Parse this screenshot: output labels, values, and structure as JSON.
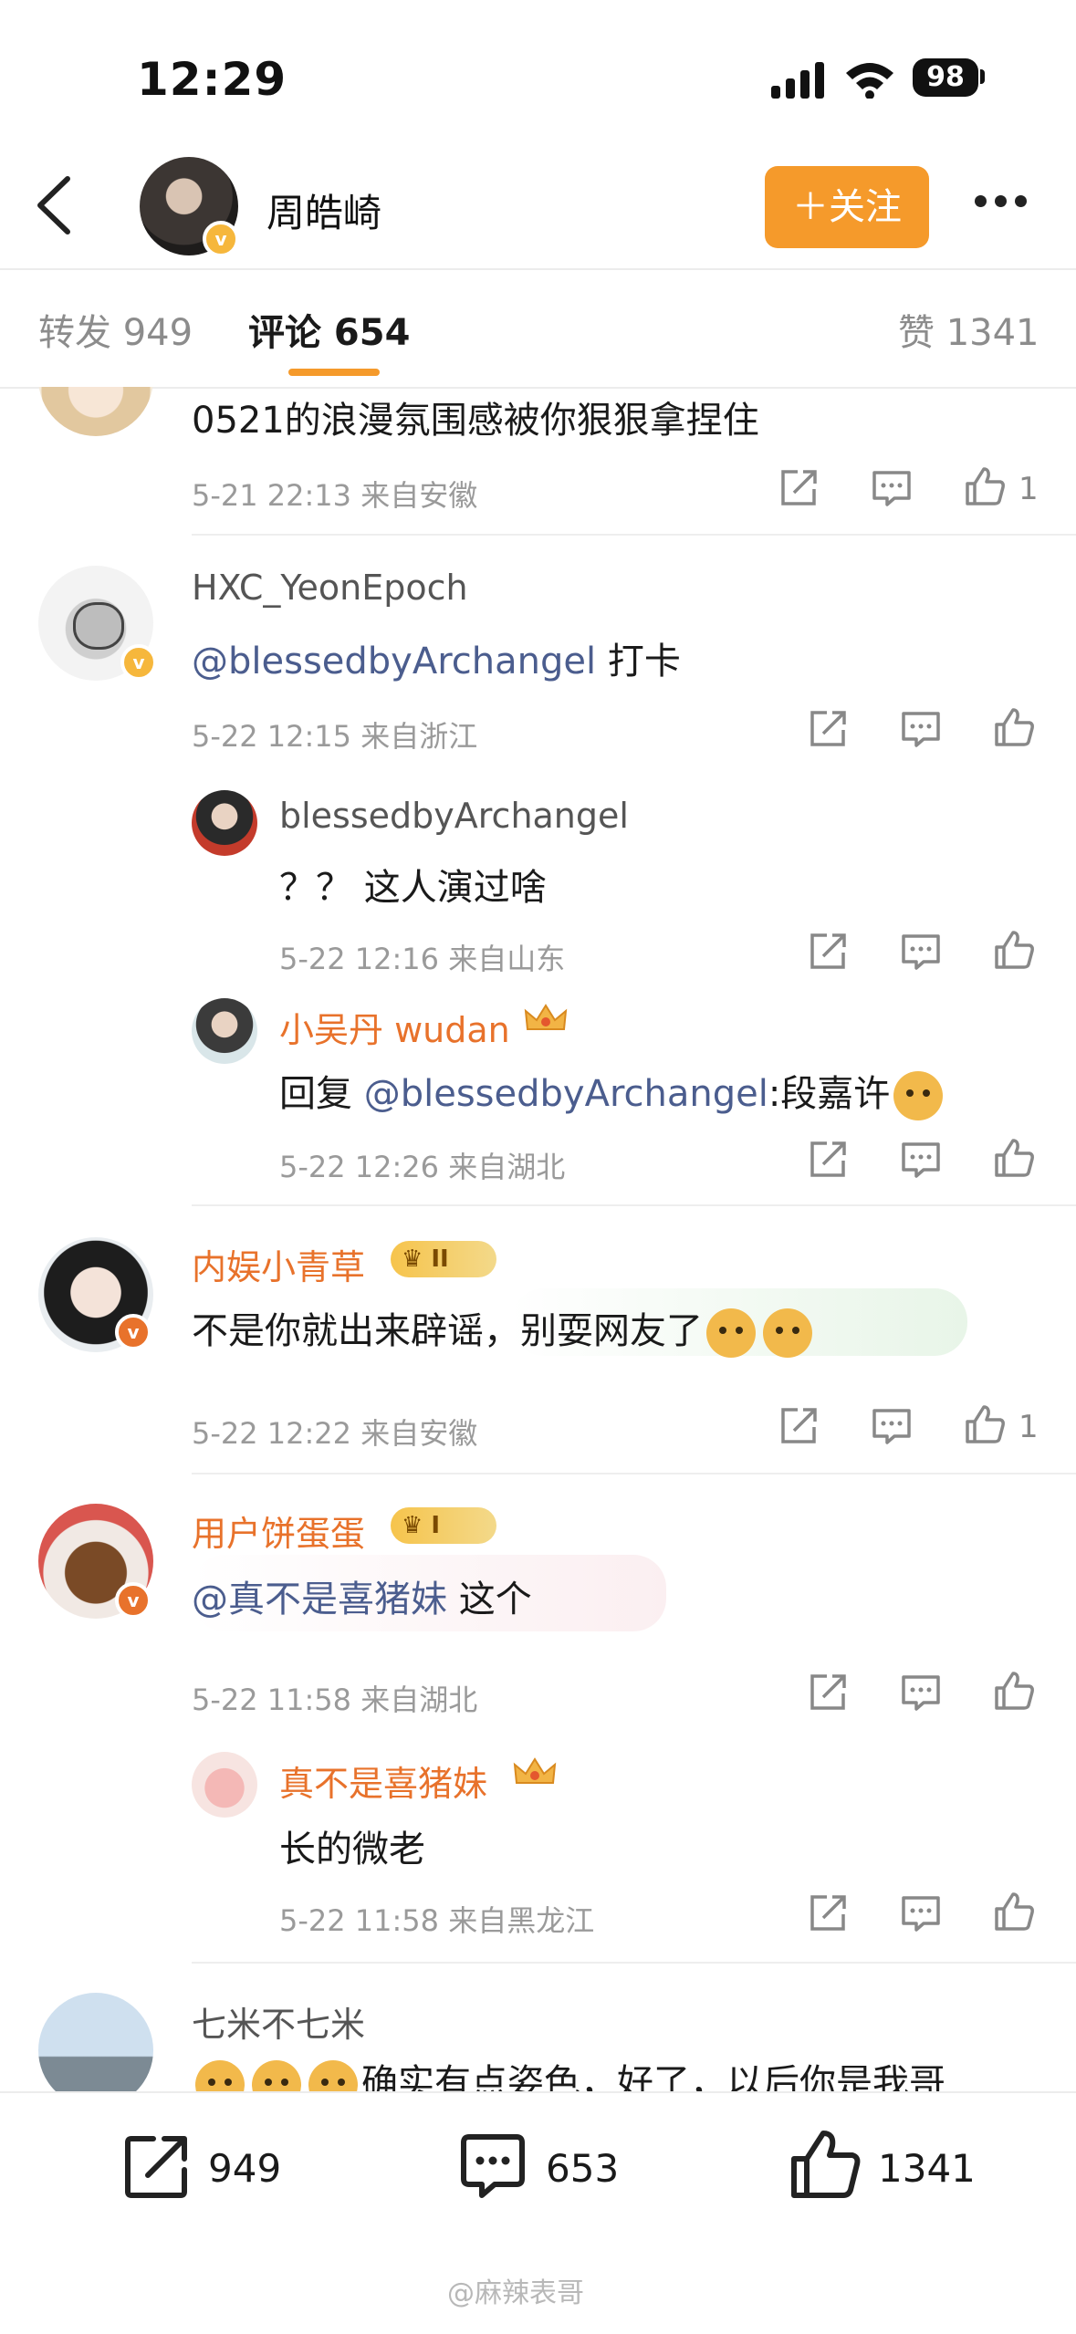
{
  "status_bar": {
    "time": "12:29",
    "battery": "98"
  },
  "header": {
    "username": "周皓崎",
    "follow_label": "＋关注"
  },
  "tabs": [
    {
      "label": "转发 949"
    },
    {
      "label": "评论 654",
      "active": true
    },
    {
      "label": "赞 1341"
    }
  ],
  "comments": {
    "c0": {
      "text": "0521的浪漫氛围感被你狠狠拿捏住",
      "meta": "5-21 22:13  来自安徽",
      "likes": "1"
    },
    "c1": {
      "user": "HXC_YeonEpoch",
      "mention": "@blessedbyArchangel",
      "text": " 打卡",
      "meta": "5-22 12:15  来自浙江"
    },
    "r1": {
      "user": "blessedbyArchangel",
      "text": "？？ 这人演过啥",
      "meta": "5-22 12:16  来自山东"
    },
    "r2": {
      "user": "小吴丹 wudan",
      "prefix": "回复 ",
      "mention": "@blessedbyArchangel",
      "text": ":段嘉许",
      "meta": "5-22 12:26  来自湖北"
    },
    "c2": {
      "user": "内娱小青草",
      "level": "II",
      "text": "不是你就出来辟谣，别耍网友了",
      "meta": "5-22 12:22  来自安徽",
      "likes": "1"
    },
    "c3": {
      "user": "用户饼蛋蛋",
      "level": "I",
      "mention": "@真不是喜猪妹",
      "text": " 这个",
      "meta": "5-22 11:58  来自湖北"
    },
    "r3": {
      "user": "真不是喜猪妹",
      "text": "长的微老",
      "meta": "5-22 11:58  来自黑龙江"
    },
    "c4": {
      "user": "七米不七米",
      "text": "确实有点姿色，好了，以后你是我哥"
    }
  },
  "bottom_bar": {
    "repost": "949",
    "comment": "653",
    "like": "1341"
  },
  "watermark": "@麻辣表哥",
  "colors": {
    "accent": "#f59a2b",
    "mention": "#4b5d8e",
    "vip_name": "#e8722b",
    "meta": "#9a9a9a"
  }
}
